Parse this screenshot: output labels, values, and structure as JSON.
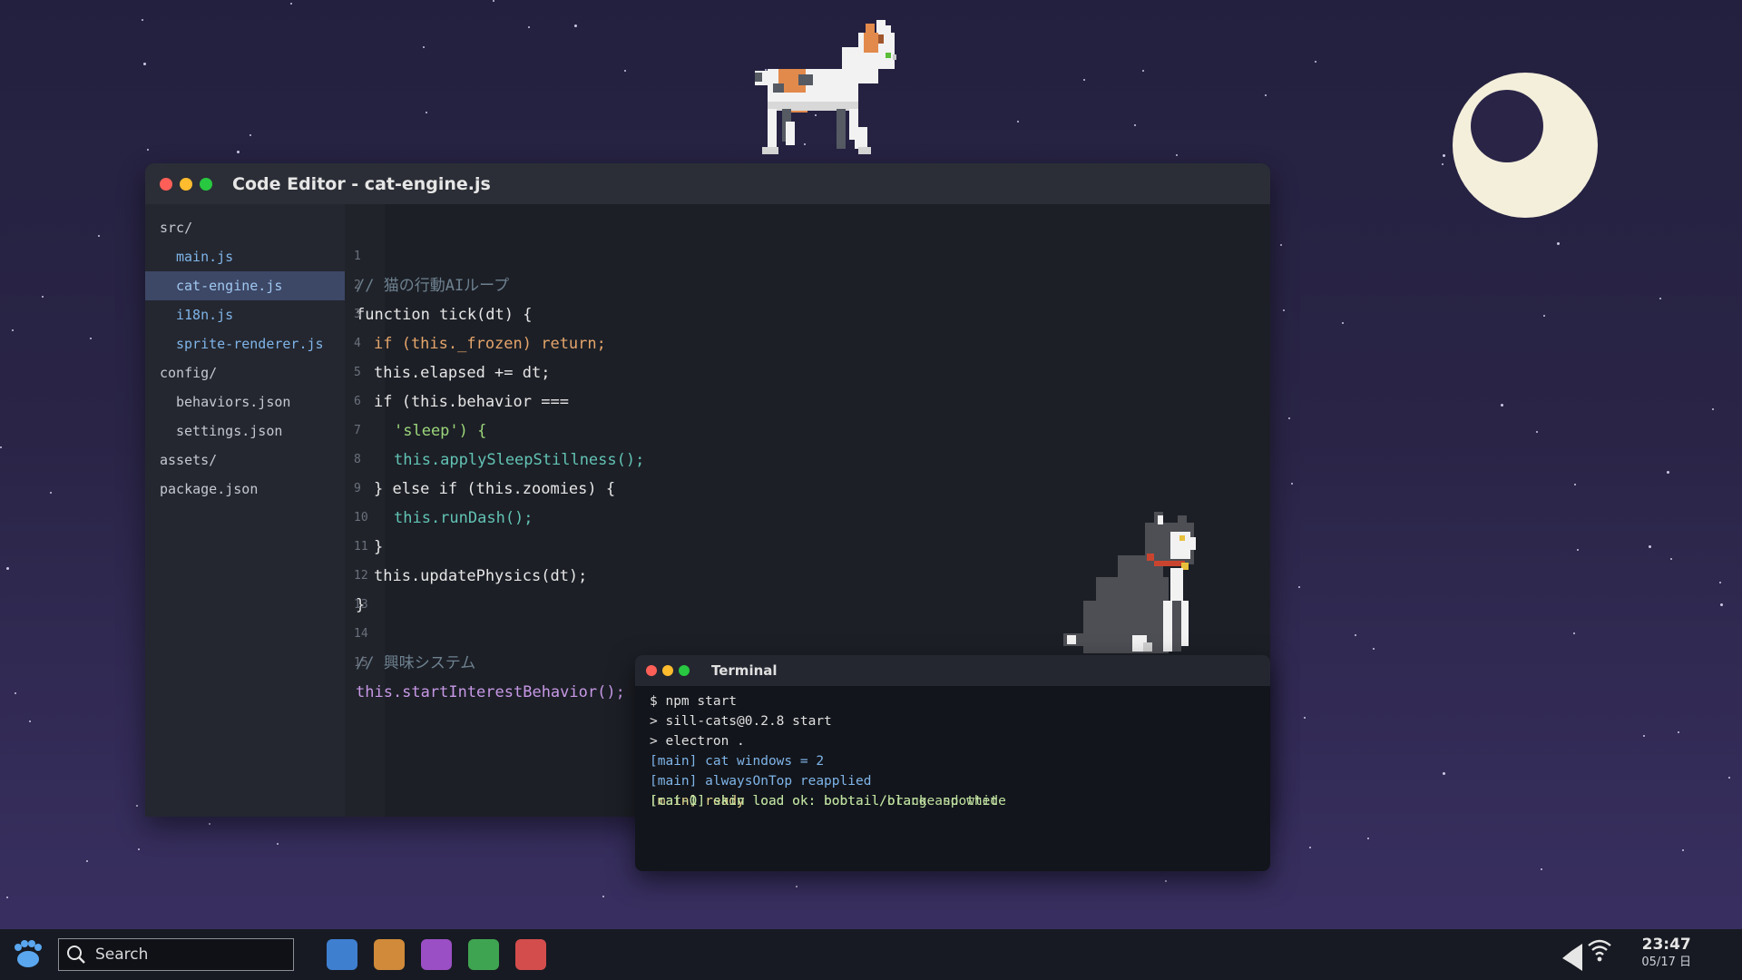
{
  "editor": {
    "title": "Code Editor - cat-engine.js",
    "sidebar": [
      {
        "label": "src/",
        "level": 0
      },
      {
        "label": "main.js",
        "level": 1
      },
      {
        "label": "cat-engine.js",
        "level": 1,
        "active": true
      },
      {
        "label": "i18n.js",
        "level": 1
      },
      {
        "label": "sprite-renderer.js",
        "level": 1
      },
      {
        "label": "config/",
        "level": 0
      },
      {
        "label": "behaviors.json",
        "level": 1
      },
      {
        "label": "settings.json",
        "level": 1
      },
      {
        "label": "assets/",
        "level": 0
      },
      {
        "label": "package.json",
        "level": 0
      }
    ],
    "lines": [
      {
        "n": "1",
        "text": "// 猫の行動AIループ"
      },
      {
        "n": "2",
        "text": "function tick(dt) {"
      },
      {
        "n": "3",
        "text": "if (this._frozen) return;"
      },
      {
        "n": "4",
        "text": "this.elapsed += dt;"
      },
      {
        "n": "5",
        "text": "if (this.behavior ==="
      },
      {
        "n": "6",
        "text": "'sleep') {"
      },
      {
        "n": "7",
        "text": "this.applySleepStillness();"
      },
      {
        "n": "8",
        "text": "} else if (this.zoomies) {"
      },
      {
        "n": "9",
        "text": "this.runDash();"
      },
      {
        "n": "10",
        "text": "}"
      },
      {
        "n": "11",
        "text": "this.updatePhysics(dt);"
      },
      {
        "n": "12",
        "text": "}"
      },
      {
        "n": "13",
        "text": ""
      },
      {
        "n": "14",
        "text": "// 興味システム"
      },
      {
        "n": "15",
        "text": "this.startInterestBehavior();"
      }
    ]
  },
  "terminal": {
    "title": "Terminal",
    "lines": [
      "$ npm start",
      "> sill-cats@0.2.8 start",
      "> electron .",
      "[main] cat windows = 2",
      "[main] alwaysOnTop reapplied",
      "[cat-0] skin load ok: bobtail/orange spotted",
      "[cat-1] skin load ok: bobtail/black and white",
      "[main] ready"
    ]
  },
  "taskbar": {
    "search_placeholder": "Search",
    "start_icon": "paw-icon",
    "apps": [
      {
        "name": "app-blue",
        "color": "#3f7fd0"
      },
      {
        "name": "app-orange",
        "color": "#d08a3a"
      },
      {
        "name": "app-purple",
        "color": "#9a4fc4"
      },
      {
        "name": "app-green",
        "color": "#3fa451"
      },
      {
        "name": "app-red",
        "color": "#d34d4d"
      }
    ],
    "tray_icons": [
      "volume-icon",
      "wifi-icon"
    ],
    "time": "23:47",
    "date": "05/17 日"
  },
  "colors": {
    "window_close": "#ff5f57",
    "window_minimize": "#febc2e",
    "window_maximize": "#28c840",
    "active_file": "#3d4766"
  }
}
